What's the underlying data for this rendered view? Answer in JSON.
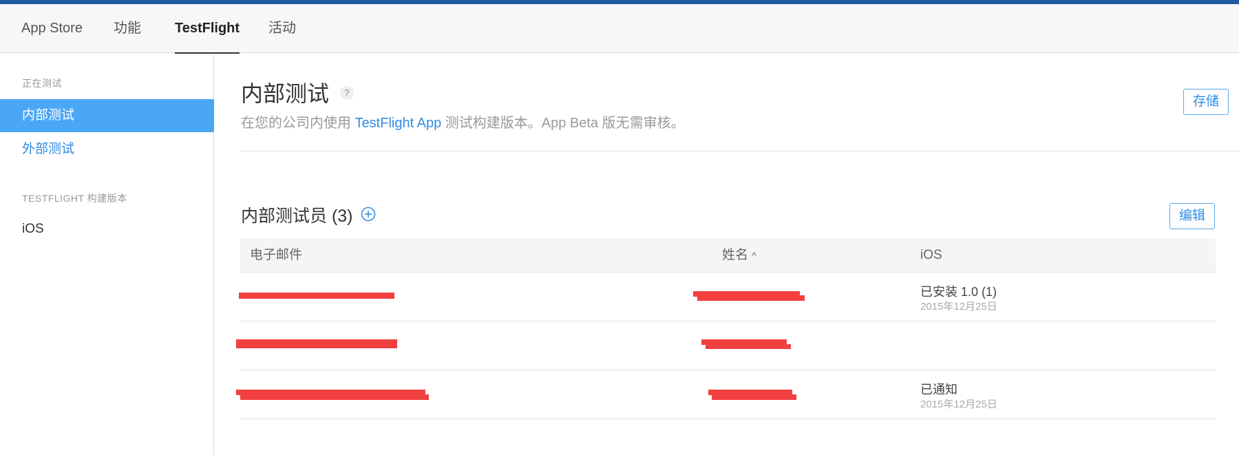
{
  "top_nav": {
    "tabs": [
      {
        "label": "App Store"
      },
      {
        "label": "功能"
      },
      {
        "label": "TestFlight",
        "active": true
      },
      {
        "label": "活动"
      }
    ]
  },
  "sidebar": {
    "section_testing": "正在测试",
    "internal": "内部测试",
    "external": "外部测试",
    "section_builds": "TESTFLIGHT 构建版本",
    "ios": "iOS"
  },
  "main": {
    "title": "内部测试",
    "help": "?",
    "subtitle_before": "在您的公司内使用 ",
    "subtitle_link": "TestFlight App",
    "subtitle_after": " 测试构建版本。App Beta 版无需审核。",
    "save_label": "存储"
  },
  "testers": {
    "title": "内部测试员 (3)",
    "edit_label": "编辑",
    "col_email": "电子邮件",
    "col_name": "姓名",
    "sort_indicator": "^",
    "col_ios": "iOS",
    "rows": [
      {
        "status": "已安装 1.0 (1)",
        "date": "2015年12月25日"
      },
      {
        "status": "",
        "date": ""
      },
      {
        "status": "已通知",
        "date": "2015年12月25日"
      }
    ]
  },
  "colors": {
    "accent": "#2f8ce6",
    "sidebar_active": "#4aa7f5",
    "redaction": "#f23f3f",
    "top_strip": "#1f5aa0"
  }
}
